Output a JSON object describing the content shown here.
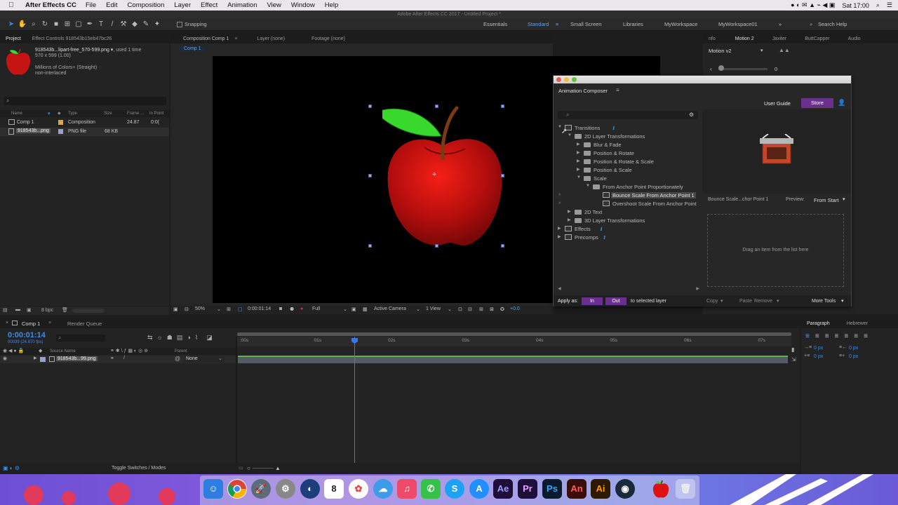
{
  "menubar": {
    "app": "After Effects CC",
    "items": [
      "File",
      "Edit",
      "Composition",
      "Layer",
      "Effect",
      "Animation",
      "View",
      "Window",
      "Help"
    ],
    "clock": "Sat 17:00"
  },
  "window_title": "Adobe After Effects CC 2017 - Untitled Project *",
  "toolbar": {
    "snapping": "Snapping",
    "workspaces": [
      "Essentials",
      "Standard",
      "Small Screen",
      "Libraries",
      "MyWorkspace",
      "MyWorkspace01"
    ],
    "active_workspace": "Standard",
    "search_help": "Search Help"
  },
  "project": {
    "tab": "Project",
    "effect_controls_tab": "Effect Controls 918543b15eb47bc26",
    "file_name": "918543b...lipart-free_570-599.png ▾",
    "used": ", used 1 time",
    "dims": "570 x 599 (1.00)",
    "colors": "Millions of Colors+ (Straight)",
    "interlace": "non-interlaced",
    "columns": [
      "Name",
      "Type",
      "Size",
      "Frame ...",
      "In Point"
    ],
    "rows": [
      {
        "name": "Comp 1",
        "type": "Composition",
        "size": "",
        "frame": "24.87",
        "inpoint": "0:0("
      },
      {
        "name": "918543b...png",
        "type": "PNG file",
        "size": "68 KB",
        "frame": "",
        "inpoint": ""
      }
    ],
    "bpc": "8 bpc"
  },
  "viewer": {
    "comp_tab": "Composition Comp 1",
    "layer_tab": "Layer (none)",
    "footage_tab": "Footage (none)",
    "comp_chip": "Comp 1",
    "zoom": "50%",
    "timecode": "0:00:01:14",
    "resolution": "Full",
    "camera": "Active Camera",
    "views": "1 View",
    "exposure": "+0.0"
  },
  "right_panel": {
    "tabs": [
      "nfo",
      "Motion 2",
      "Jaxiter",
      "ButtCapper",
      "Audio"
    ],
    "motion_preset": "Motion v2",
    "slider_value": "0"
  },
  "ac": {
    "title": "Animation Composer",
    "user_guide": "User Guide",
    "store": "Store",
    "tree": [
      {
        "label": "Transitions",
        "level": 0,
        "kind": "icon",
        "open": true,
        "info": true
      },
      {
        "label": "2D Layer Transformations",
        "level": 1,
        "kind": "folder",
        "open": true
      },
      {
        "label": "Blur & Fade",
        "level": 2,
        "kind": "folder",
        "open": false
      },
      {
        "label": "Position & Rotate",
        "level": 2,
        "kind": "folder",
        "open": false
      },
      {
        "label": "Position & Rotate & Scale",
        "level": 2,
        "kind": "folder",
        "open": false
      },
      {
        "label": "Position & Scale",
        "level": 2,
        "kind": "folder",
        "open": false
      },
      {
        "label": "Scale",
        "level": 2,
        "kind": "folder",
        "open": true
      },
      {
        "label": "From Anchor Point Proportionately",
        "level": 3,
        "kind": "folder",
        "open": true
      },
      {
        "label": "Bounce Scale From Anchor Point 1",
        "level": 4,
        "kind": "item",
        "selected": true
      },
      {
        "label": "Overshoot Scale From Anchor Point",
        "level": 4,
        "kind": "item"
      },
      {
        "label": "2D Text",
        "level": 1,
        "kind": "folder",
        "open": false
      },
      {
        "label": "3D Layer Transformations",
        "level": 1,
        "kind": "folder",
        "open": false
      },
      {
        "label": "Effects",
        "level": 0,
        "kind": "icon",
        "open": false,
        "info": true
      },
      {
        "label": "Precomps",
        "level": 0,
        "kind": "icon",
        "open": false,
        "info": true
      }
    ],
    "preview_name": "Bounce Scale...chor Point 1",
    "preview_label": "Preview:",
    "preview_mode": "From Start",
    "drop_hint": "Drag an item from the list here",
    "apply_as": "Apply as:",
    "in": "In",
    "out": "Out",
    "to_selected": "to selected layer",
    "copy": "Copy",
    "paste": "Paste",
    "remove": "Remove",
    "more_tools": "More Tools"
  },
  "timeline": {
    "tab": "Comp 1",
    "render_queue": "Render Queue",
    "timecode": "0:00:01:14",
    "frames": "00039 (24.870 fps)",
    "columns": [
      "Source Name",
      "Parent"
    ],
    "layer_name": "918543b...99.png",
    "parent": "None",
    "ticks": [
      ":00s",
      "01s",
      "02s",
      "03s",
      "04s",
      "05s",
      "06s",
      "07s"
    ],
    "toggle": "Toggle Switches / Modes"
  },
  "paragraph": {
    "tabs": [
      "Paragraph",
      "Hebrewer"
    ],
    "px_values": [
      "0 px",
      "0 px",
      "0 px",
      "0 px"
    ]
  },
  "dock": {
    "apps": [
      "Ae",
      "Pr",
      "Ps",
      "An",
      "Ai"
    ]
  },
  "colors": {
    "accent": "#3d8ce8",
    "ac_purple": "#6b2f8e",
    "layer_bar": "#575a66",
    "playhead": "#2f7cf0"
  }
}
